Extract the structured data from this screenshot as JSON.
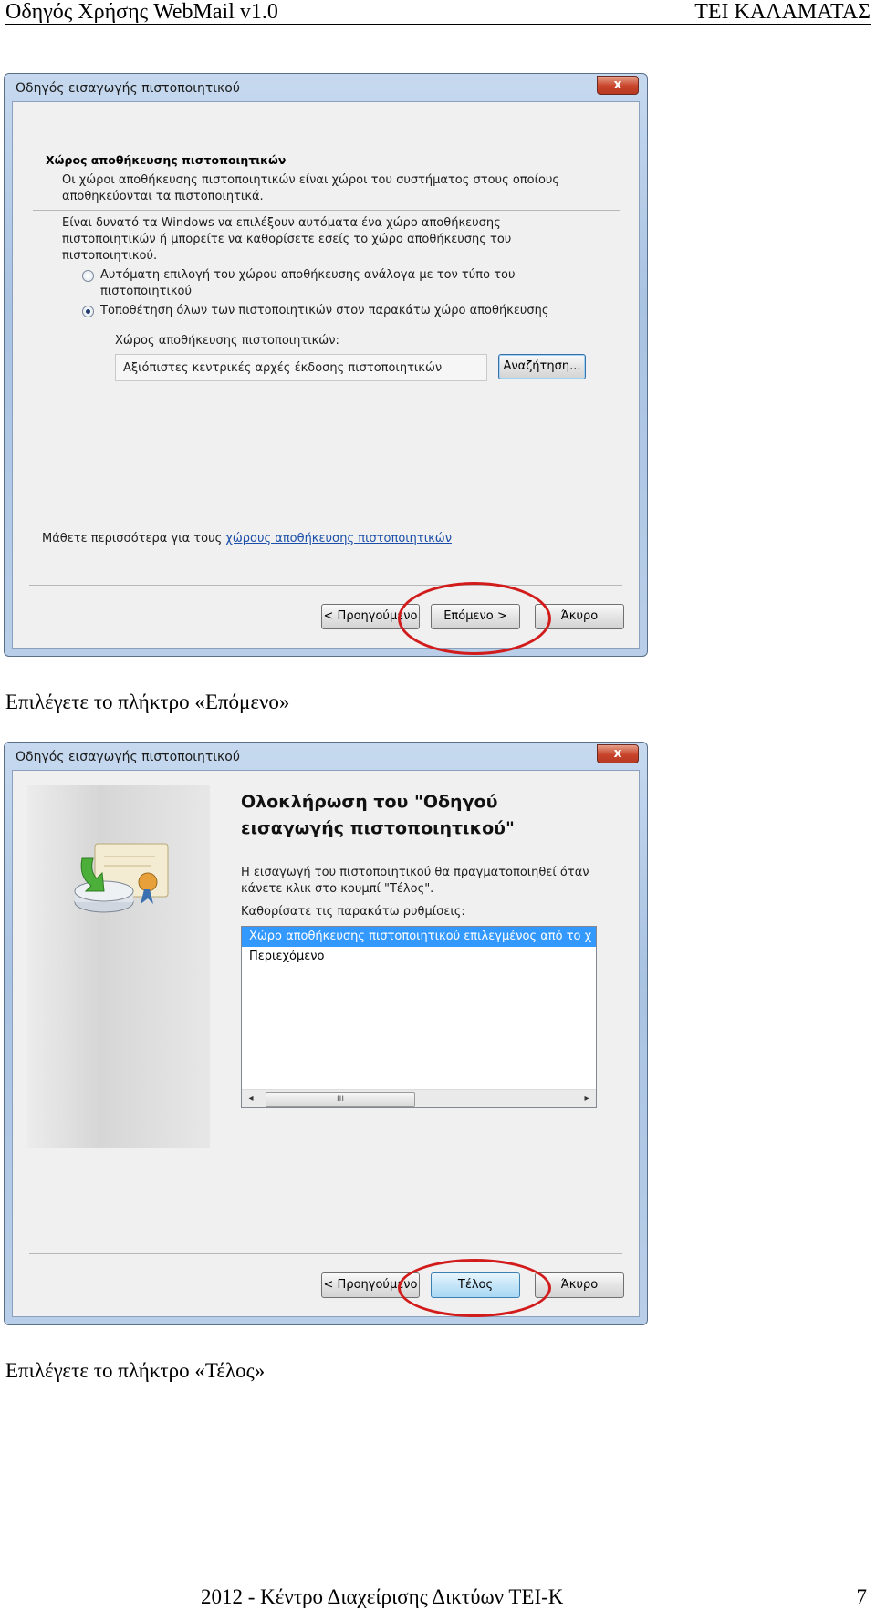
{
  "header": {
    "left": "Οδηγός Χρήσης WebMail v1.0",
    "right": "ΤΕΙ ΚΑΛΑΜΑΤΑΣ"
  },
  "dialog1": {
    "title": "Οδηγός εισαγωγής πιστοποιητικού",
    "close_label": "x",
    "section_title": "Χώρος αποθήκευσης πιστοποιητικών",
    "intro_line1": "Οι χώροι αποθήκευσης πιστοποιητικών είναι χώροι του συστήματος στους οποίους",
    "intro_line2": "αποθηκεύονται τα πιστοποιητικά.",
    "desc_line1": "Είναι δυνατό τα Windows να επιλέξουν αυτόματα ένα χώρο αποθήκευσης",
    "desc_line2": "πιστοποιητικών ή μπορείτε να καθορίσετε εσείς το χώρο αποθήκευσης του",
    "desc_line3": "πιστοποιητικού.",
    "radio_auto_line1": "Αυτόματη επιλογή του χώρου αποθήκευσης ανάλογα με τον τύπο του",
    "radio_auto_line2": "πιστοποιητικού",
    "radio_manual": "Τοποθέτηση όλων των πιστοποιητικών στον παρακάτω χώρο αποθήκευσης",
    "store_label": "Χώρος αποθήκευσης πιστοποιητικών:",
    "store_value": "Αξιόπιστες κεντρικές αρχές έκδοσης πιστοποιητικών",
    "browse_button": "Αναζήτηση...",
    "learn_prefix": "Μάθετε περισσότερα για τους",
    "learn_link": "χώρους αποθήκευσης πιστοποιητικών",
    "back_button": "< Προηγούμενο",
    "next_button": "Επόμενο >",
    "cancel_button": "Άκυρο"
  },
  "caption1": "Επιλέγετε το πλήκτρο «Επόμενο»",
  "dialog2": {
    "title": "Οδηγός εισαγωγής πιστοποιητικού",
    "close_label": "x",
    "heading_line1": "Ολοκλήρωση του \"Οδηγού",
    "heading_line2": "εισαγωγής πιστοποιητικού\"",
    "info_line1": "Η εισαγωγή του πιστοποιητικού θα πραγματοποιηθεί όταν",
    "info_line2": "κάνετε κλικ στο κουμπί \"Τέλος\".",
    "settings_label": "Καθορίσατε τις παρακάτω ρυθμίσεις:",
    "list_items": [
      "Χώρο αποθήκευσης πιστοποιητικού επιλεγμένος από το χ",
      "Περιεχόμενο"
    ],
    "scroll_thumb": "III",
    "back_button": "< Προηγούμενο",
    "finish_button": "Τέλος",
    "cancel_button": "Άκυρο"
  },
  "caption2": "Επιλέγετε το πλήκτρο «Τέλος»",
  "footer": {
    "text": "2012 - Κέντρο Διαχείρισης Δικτύων ΤΕΙ-Κ",
    "page": "7"
  }
}
